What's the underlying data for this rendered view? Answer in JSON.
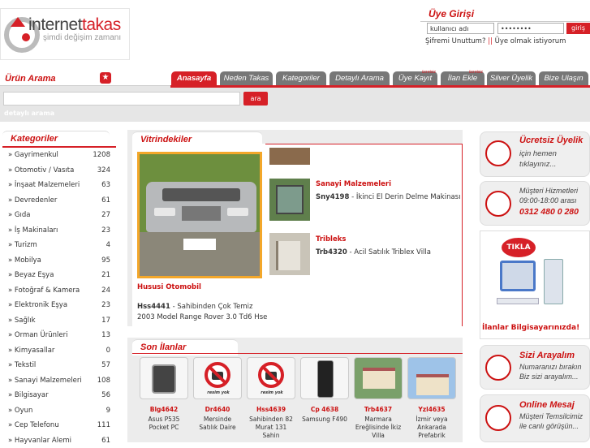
{
  "logo": {
    "name_a": "internet",
    "name_b": "takas",
    "tagline": "şimdi değişim zamanı"
  },
  "login": {
    "title": "Üye Girişi",
    "username_value": "kullanıcı adı",
    "password_value": "••••••••",
    "submit": "giriş",
    "forgot": "Şifremi Unuttum?",
    "sep": "||",
    "register": "Üye olmak istiyorum"
  },
  "search": {
    "title": "Ürün Arama",
    "button": "ara",
    "detailed": "detaylı arama"
  },
  "nav": {
    "tabs": [
      {
        "label": "Anasayfa",
        "badge": ""
      },
      {
        "label": "Neden Takas",
        "badge": ""
      },
      {
        "label": "Kategoriler",
        "badge": ""
      },
      {
        "label": "Detaylı Arama",
        "badge": ""
      },
      {
        "label": "Üye Kayıt",
        "badge": "ücretsiz"
      },
      {
        "label": "İlan Ekle",
        "badge": "ücretsiz"
      },
      {
        "label": "Silver Üyelik",
        "badge": ""
      },
      {
        "label": "Bize Ulaşın",
        "badge": ""
      }
    ],
    "accent": "#d62027"
  },
  "categories": {
    "title": "Kategoriler",
    "items": [
      {
        "name": "» Gayrimenkul",
        "count": "1208"
      },
      {
        "name": "» Otomotiv / Vasıta",
        "count": "324"
      },
      {
        "name": "» İnşaat Malzemeleri",
        "count": "63"
      },
      {
        "name": "» Devredenler",
        "count": "61"
      },
      {
        "name": "» Gıda",
        "count": "27"
      },
      {
        "name": "» İş Makinaları",
        "count": "23"
      },
      {
        "name": "» Turizm",
        "count": "4"
      },
      {
        "name": "» Mobilya",
        "count": "95"
      },
      {
        "name": "» Beyaz Eşya",
        "count": "21"
      },
      {
        "name": "» Fotoğraf & Kamera",
        "count": "24"
      },
      {
        "name": "» Elektronik Eşya",
        "count": "23"
      },
      {
        "name": "» Sağlık",
        "count": "17"
      },
      {
        "name": "» Orman Ürünleri",
        "count": "13"
      },
      {
        "name": "» Kimyasallar",
        "count": "0"
      },
      {
        "name": "» Tekstil",
        "count": "57"
      },
      {
        "name": "» Sanayi Malzemeleri",
        "count": "108"
      },
      {
        "name": "» Bilgisayar",
        "count": "56"
      },
      {
        "name": "» Oyun",
        "count": "9"
      },
      {
        "name": "» Cep Telefonu",
        "count": "111"
      },
      {
        "name": "» Hayvanlar Alemi",
        "count": "61"
      }
    ]
  },
  "showcase": {
    "title": "Vitrindekiler",
    "featured": {
      "category": "Hususi Otomobil",
      "code": "Hss4441",
      "sep": " - ",
      "text1": "Sahibinden Çok Temiz",
      "text2": "2003 Model Range Rover 3.0 Td6 Hse"
    },
    "items": [
      {
        "category": "",
        "code": "",
        "text": ""
      },
      {
        "category": "Sanayi Malzemeleri",
        "code": "Sny4198",
        "text": " - İkinci El Derin Delme Makinası"
      },
      {
        "category": "Tribleks",
        "code": "Trb4320",
        "text": " - Acil Satılık Triblex Villa"
      }
    ]
  },
  "latest": {
    "title": "Son İlanlar",
    "no_photo": "resim yok",
    "items": [
      {
        "code": "Blg4642",
        "l1": "Asus P535",
        "l2": "Pocket PC",
        "l3": ""
      },
      {
        "code": "Dr4640",
        "l1": "Mersinde",
        "l2": "Satılık Daire",
        "l3": ""
      },
      {
        "code": "Hss4639",
        "l1": "Sahibinden 82",
        "l2": "Murat 131",
        "l3": "Sahin"
      },
      {
        "code": "Cp 4638",
        "l1": "Samsung F490",
        "l2": "",
        "l3": ""
      },
      {
        "code": "Trb4637",
        "l1": "Marmara",
        "l2": "Ereğlisinde İkiz",
        "l3": "Villa"
      },
      {
        "code": "Yzl4635",
        "l1": "İzmir veya",
        "l2": "Ankarada",
        "l3": "Prefabrik"
      }
    ]
  },
  "right": {
    "membership": {
      "h": "Ücretsiz Üyelik",
      "s1": "için hemen",
      "s2": "tıklayınız..."
    },
    "support": {
      "s1": "Müşteri Hizmetleri",
      "s2": "09:00-18:00 arası",
      "phone": "0312 480 0 280"
    },
    "ad": {
      "badge": "TIKLA",
      "caption": "İlanlar Bilgisayarınızda!"
    },
    "callback": {
      "h": "Sizi Arayalım",
      "s1": "Numaranızı bırakın",
      "s2": "Biz sizi arayalım..."
    },
    "chat": {
      "h": "Online Mesaj",
      "s1": "Müşteri Temsilcimiz",
      "s2": "ile canlı görüşün..."
    }
  }
}
